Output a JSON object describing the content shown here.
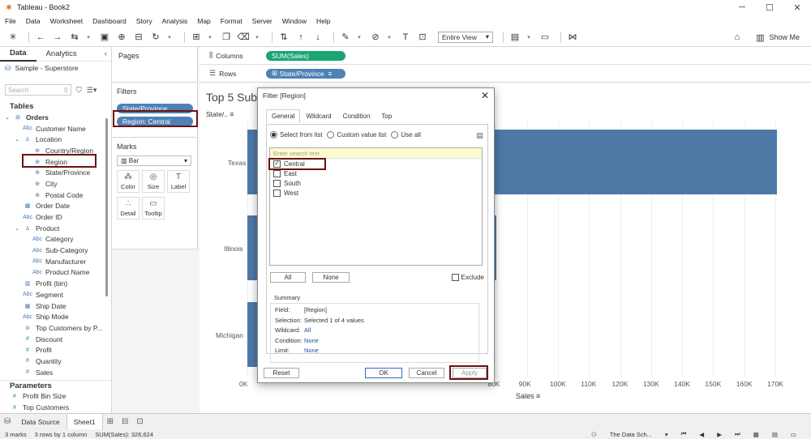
{
  "window": {
    "title": "Tableau - Book2"
  },
  "menu": [
    "File",
    "Data",
    "Worksheet",
    "Dashboard",
    "Story",
    "Analysis",
    "Map",
    "Format",
    "Server",
    "Window",
    "Help"
  ],
  "toolbar": {
    "fit": "Entire View",
    "show_me": "Show Me"
  },
  "data_pane": {
    "tabs": [
      "Data",
      "Analytics"
    ],
    "datasource": "Sample - Superstore",
    "search_placeholder": "Search",
    "tables_header": "Tables",
    "fields": [
      {
        "label": "Orders",
        "icon": "table-icon",
        "indent": 0,
        "expand": "⌄"
      },
      {
        "label": "Customer Name",
        "icon": "Abc",
        "indent": 1
      },
      {
        "label": "Location",
        "icon": "hierarchy-icon",
        "indent": 1,
        "expand": "⌄"
      },
      {
        "label": "Country/Region",
        "icon": "globe-icon",
        "indent": 2
      },
      {
        "label": "Region",
        "icon": "globe-icon",
        "indent": 2
      },
      {
        "label": "State/Province",
        "icon": "globe-icon",
        "indent": 2
      },
      {
        "label": "City",
        "icon": "globe-icon",
        "indent": 2
      },
      {
        "label": "Postal Code",
        "icon": "globe-icon",
        "indent": 2
      },
      {
        "label": "Order Date",
        "icon": "date-icon",
        "indent": 1
      },
      {
        "label": "Order ID",
        "icon": "Abc",
        "indent": 1
      },
      {
        "label": "Product",
        "icon": "hierarchy-icon",
        "indent": 1,
        "expand": "⌄"
      },
      {
        "label": "Category",
        "icon": "Abc",
        "indent": 2
      },
      {
        "label": "Sub-Category",
        "icon": "Abc",
        "indent": 2
      },
      {
        "label": "Manufacturer",
        "icon": "Abc",
        "indent": 2
      },
      {
        "label": "Product Name",
        "icon": "Abc",
        "indent": 2
      },
      {
        "label": "Profit (bin)",
        "icon": "bin-icon",
        "indent": 1
      },
      {
        "label": "Segment",
        "icon": "Abc",
        "indent": 1
      },
      {
        "label": "Ship Date",
        "icon": "date-icon",
        "indent": 1
      },
      {
        "label": "Ship Mode",
        "icon": "Abc",
        "indent": 1
      },
      {
        "label": "Top Customers by P...",
        "icon": "set-icon",
        "indent": 1
      },
      {
        "label": "Discount",
        "icon": "#",
        "indent": 1,
        "measure": true
      },
      {
        "label": "Profit",
        "icon": "#",
        "indent": 1,
        "measure": true
      },
      {
        "label": "Quantity",
        "icon": "#",
        "indent": 1,
        "measure": true
      },
      {
        "label": "Sales",
        "icon": "#",
        "indent": 1,
        "measure": true
      }
    ],
    "parameters_header": "Parameters",
    "parameters": [
      {
        "label": "Profit Bin Size",
        "icon": "#"
      },
      {
        "label": "Top Customers",
        "icon": "#"
      }
    ]
  },
  "cards": {
    "pages": "Pages",
    "filters": "Filters",
    "filter_pills": [
      "State/Province",
      "Region: Central"
    ],
    "marks": "Marks",
    "mark_type": "Bar",
    "mark_buttons": [
      {
        "label": "Color",
        "icon": "color-icon"
      },
      {
        "label": "Size",
        "icon": "size-icon"
      },
      {
        "label": "Label",
        "icon": "label-icon"
      },
      {
        "label": "Detail",
        "icon": "detail-icon"
      },
      {
        "label": "Tooltip",
        "icon": "tooltip-icon"
      }
    ]
  },
  "shelves": {
    "columns_label": "Columns",
    "columns_pill": "SUM(Sales)",
    "rows_label": "Rows",
    "rows_pill": "State/Province"
  },
  "view": {
    "title": "Top 5 Subc",
    "state_header": "State/..",
    "x_axis_label": "Sales",
    "rows": [
      "Texas",
      "Illinois",
      "Michigan"
    ],
    "visible_ticks": [
      {
        "label": "0K",
        "v": 0
      },
      {
        "label": "80K",
        "v": 80
      },
      {
        "label": "90K",
        "v": 90
      },
      {
        "label": "100K",
        "v": 100
      },
      {
        "label": "110K",
        "v": 110
      },
      {
        "label": "120K",
        "v": 120
      },
      {
        "label": "130K",
        "v": 130
      },
      {
        "label": "140K",
        "v": 140
      },
      {
        "label": "150K",
        "v": 150
      },
      {
        "label": "160K",
        "v": 160
      },
      {
        "label": "170K",
        "v": 170
      }
    ]
  },
  "chart_data": {
    "type": "bar",
    "categories": [
      "Texas",
      "Illinois",
      "Michigan"
    ],
    "values": [
      170485,
      80166,
      76270
    ],
    "xlabel": "Sales",
    "ylabel": "State/..",
    "xlim": [
      0,
      175000
    ]
  },
  "dialog": {
    "title": "Filter [Region]",
    "tabs": [
      "General",
      "Wildcard",
      "Condition",
      "Top"
    ],
    "radio_options": [
      "Select from list",
      "Custom value list",
      "Use all"
    ],
    "search_placeholder": "Enter search text",
    "items": [
      {
        "label": "Central",
        "checked": true
      },
      {
        "label": "East",
        "checked": false
      },
      {
        "label": "South",
        "checked": false
      },
      {
        "label": "West",
        "checked": false
      }
    ],
    "all_label": "All",
    "none_label": "None",
    "exclude_label": "Exclude",
    "summary_label": "Summary",
    "summary": [
      {
        "k": "Field:",
        "v": "[Region]",
        "link": false
      },
      {
        "k": "Selection:",
        "v": "Selected 1 of 4 values",
        "link": false
      },
      {
        "k": "Wildcard:",
        "v": "All",
        "link": true
      },
      {
        "k": "Condition:",
        "v": "None",
        "link": true
      },
      {
        "k": "Limit:",
        "v": "None",
        "link": true
      }
    ],
    "buttons": {
      "reset": "Reset",
      "ok": "OK",
      "cancel": "Cancel",
      "apply": "Apply"
    }
  },
  "sheet_tabs": {
    "data_source": "Data Source",
    "sheet": "Sheet1"
  },
  "status": {
    "marks": "3 marks",
    "dims": "3 rows by 1 column",
    "sum": "SUM(Sales): 326,624",
    "user": "The Data Sch..."
  },
  "colors": {
    "bar": "#4e79a7",
    "pill_green": "#1aa572",
    "pill_blue": "#4e81b4",
    "highlight": "#6b1212"
  }
}
